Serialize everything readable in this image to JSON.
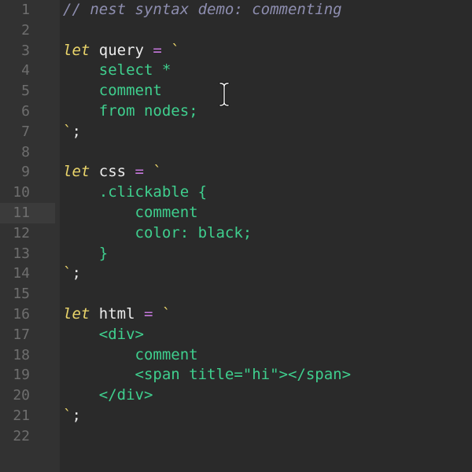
{
  "editor": {
    "lines": [
      {
        "num": "1",
        "tokens": [
          {
            "t": "// nest syntax demo: commenting",
            "c": "comment"
          }
        ]
      },
      {
        "num": "2",
        "tokens": []
      },
      {
        "num": "3",
        "tokens": [
          {
            "t": "let",
            "c": "kw"
          },
          {
            "t": " query ",
            "c": "ident"
          },
          {
            "t": "=",
            "c": "op"
          },
          {
            "t": " `",
            "c": "tick"
          }
        ]
      },
      {
        "num": "4",
        "tokens": [
          {
            "t": "    select *",
            "c": "str"
          }
        ]
      },
      {
        "num": "5",
        "tokens": [
          {
            "t": "    comment",
            "c": "str"
          }
        ]
      },
      {
        "num": "6",
        "tokens": [
          {
            "t": "    from nodes;",
            "c": "str"
          }
        ]
      },
      {
        "num": "7",
        "tokens": [
          {
            "t": "`",
            "c": "tick"
          },
          {
            "t": ";",
            "c": "punct"
          }
        ]
      },
      {
        "num": "8",
        "tokens": []
      },
      {
        "num": "9",
        "tokens": [
          {
            "t": "let",
            "c": "kw"
          },
          {
            "t": " css ",
            "c": "ident"
          },
          {
            "t": "=",
            "c": "op"
          },
          {
            "t": " `",
            "c": "tick"
          }
        ]
      },
      {
        "num": "10",
        "tokens": [
          {
            "t": "    .clickable {",
            "c": "str"
          }
        ]
      },
      {
        "num": "11",
        "tokens": [
          {
            "t": "        comment",
            "c": "str"
          }
        ]
      },
      {
        "num": "12",
        "tokens": [
          {
            "t": "        color: black;",
            "c": "str"
          }
        ]
      },
      {
        "num": "13",
        "tokens": [
          {
            "t": "    }",
            "c": "str"
          }
        ]
      },
      {
        "num": "14",
        "tokens": [
          {
            "t": "`",
            "c": "tick"
          },
          {
            "t": ";",
            "c": "punct"
          }
        ]
      },
      {
        "num": "15",
        "tokens": []
      },
      {
        "num": "16",
        "tokens": [
          {
            "t": "let",
            "c": "kw"
          },
          {
            "t": " html ",
            "c": "ident"
          },
          {
            "t": "=",
            "c": "op"
          },
          {
            "t": " `",
            "c": "tick"
          }
        ]
      },
      {
        "num": "17",
        "tokens": [
          {
            "t": "    <div>",
            "c": "str"
          }
        ]
      },
      {
        "num": "18",
        "tokens": [
          {
            "t": "        comment",
            "c": "str"
          }
        ]
      },
      {
        "num": "19",
        "tokens": [
          {
            "t": "        <span title=\"hi\"></span>",
            "c": "str"
          }
        ]
      },
      {
        "num": "20",
        "tokens": [
          {
            "t": "    </div>",
            "c": "str"
          }
        ]
      },
      {
        "num": "21",
        "tokens": [
          {
            "t": "`",
            "c": "tick"
          },
          {
            "t": ";",
            "c": "punct"
          }
        ]
      },
      {
        "num": "22",
        "tokens": []
      }
    ],
    "active_line": "11",
    "cursor_icon": "text-ibeam-cursor-icon"
  },
  "colors": {
    "background": "#2a2a2a",
    "gutter": "#323232",
    "line_number": "#6e6e6e",
    "comment": "#8e8eb0",
    "keyword": "#e9d46a",
    "operator": "#c678dd",
    "string": "#3fcf8e"
  }
}
